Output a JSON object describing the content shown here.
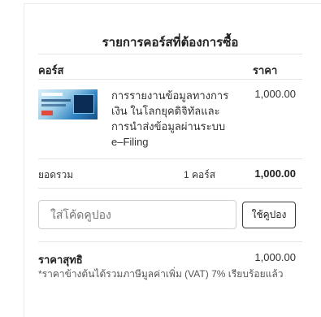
{
  "cart": {
    "title": "รายการคอร์สที่ต้องการซื้อ",
    "column_course": "คอร์ส",
    "column_price": "ราคา",
    "items": [
      {
        "name": "การรายงานข้อมูลทางการเงิน ในโลกยุคดิจิทัลและการนำส่งข้อมูลผ่านระบบ e–Filing",
        "price": "1,000.00",
        "thumbnail_icon": "course-thumbnail"
      }
    ],
    "subtotal_label": "ยอดรวม",
    "subtotal_count": "1 คอร์ส",
    "subtotal_value": "1,000.00",
    "coupon_placeholder": "ใส่โค้ดคูปอง",
    "coupon_button": "ใช้คูปอง",
    "net_label": "ราคาสุทธิ",
    "net_value": "1,000.00",
    "vat_note": "*ราคาข้างต้นได้รวมภาษีมูลค่าเพิ่ม (VAT) 7% เรียบร้อยแล้ว"
  }
}
